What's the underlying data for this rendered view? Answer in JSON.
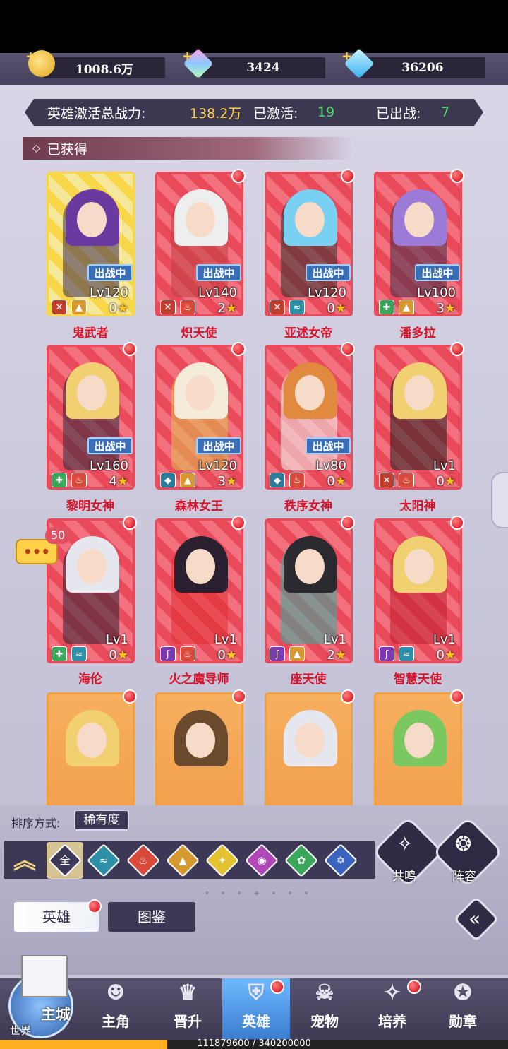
{
  "resources": {
    "gold": "1008.6万",
    "crystal": "3424",
    "diamond": "36206"
  },
  "stats": {
    "power_label": "英雄激活总战力:",
    "power_value": "138.2万",
    "activated_label": "已激活:",
    "activated_value": "19",
    "deployed_label": "已出战:",
    "deployed_value": "7"
  },
  "section_title": "已获得",
  "heroes": [
    {
      "name": "鬼武者",
      "lv": "Lv120",
      "stars": "0",
      "deployed": "出战中",
      "elements": [
        "blade",
        "light"
      ]
    },
    {
      "name": "炽天使",
      "lv": "Lv140",
      "stars": "2",
      "deployed": "出战中",
      "elements": [
        "blade",
        "fire"
      ]
    },
    {
      "name": "亚述女帝",
      "lv": "Lv120",
      "stars": "0",
      "deployed": "出战中",
      "elements": [
        "blade",
        "water"
      ]
    },
    {
      "name": "潘多拉",
      "lv": "Lv100",
      "stars": "3",
      "deployed": "出战中",
      "elements": [
        "cross",
        "light"
      ]
    },
    {
      "name": "黎明女神",
      "lv": "Lv160",
      "stars": "4",
      "deployed": "出战中",
      "elements": [
        "cross",
        "fire"
      ]
    },
    {
      "name": "森林女王",
      "lv": "Lv120",
      "stars": "3",
      "deployed": "出战中",
      "elements": [
        "shield",
        "light"
      ]
    },
    {
      "name": "秩序女神",
      "lv": "Lv80",
      "stars": "0",
      "deployed": "出战中",
      "elements": [
        "shield",
        "fire"
      ]
    },
    {
      "name": "太阳神",
      "lv": "Lv1",
      "stars": "0",
      "deployed": "",
      "elements": [
        "blade",
        "fire"
      ]
    },
    {
      "name": "海伦",
      "lv": "Lv1",
      "stars": "0",
      "deployed": "",
      "elements": [
        "cross",
        "water"
      ]
    },
    {
      "name": "火之魔导师",
      "lv": "Lv1",
      "stars": "0",
      "deployed": "",
      "elements": [
        "staff",
        "fire"
      ]
    },
    {
      "name": "座天使",
      "lv": "Lv1",
      "stars": "2",
      "deployed": "",
      "elements": [
        "staff",
        "light"
      ]
    },
    {
      "name": "智慧天使",
      "lv": "Lv1",
      "stars": "0",
      "deployed": "",
      "elements": [
        "staff",
        "water"
      ]
    }
  ],
  "chat_badge": "50",
  "sort": {
    "label": "排序方式:",
    "value": "稀有度"
  },
  "filter_all": "全",
  "buttons": {
    "resonance": "共鸣",
    "lineup": "阵容"
  },
  "tabs": {
    "heroes": "英雄",
    "codex": "图鉴"
  },
  "nav": {
    "main_city": "主城",
    "world": "世界",
    "items": [
      "主角",
      "晋升",
      "英雄",
      "宠物",
      "培养",
      "勋章"
    ]
  },
  "exp": "111879600 / 340200000",
  "colors": {
    "rarity_red": "#e84a5a",
    "rarity_gold": "#f7d64a",
    "rarity_orange": "#f0a040",
    "name_red": "#d8142a",
    "stat_yellow": "#ffd34a",
    "stat_green": "#4cd964"
  }
}
